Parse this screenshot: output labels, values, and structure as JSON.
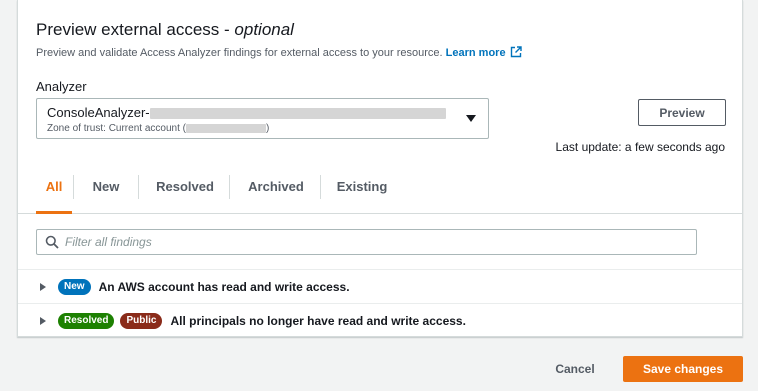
{
  "section": {
    "title_main": "Preview external access - ",
    "title_optional": "optional",
    "description": "Preview and validate Access Analyzer findings for external access to your resource.",
    "learn_more": "Learn more"
  },
  "analyzer": {
    "label": "Analyzer",
    "selected_name": "ConsoleAnalyzer-",
    "zone_prefix": "Zone of trust: Current account (",
    "zone_suffix": ")"
  },
  "preview_button": "Preview",
  "last_update": "Last update: a few seconds ago",
  "tabs": [
    {
      "label": "All"
    },
    {
      "label": "New"
    },
    {
      "label": "Resolved"
    },
    {
      "label": "Archived"
    },
    {
      "label": "Existing"
    }
  ],
  "filter": {
    "placeholder": "Filter all findings"
  },
  "findings": [
    {
      "badges": [
        {
          "label": "New",
          "color": "#0073bb"
        }
      ],
      "text": "An AWS account has read and write access."
    },
    {
      "badges": [
        {
          "label": "Resolved",
          "color": "#1d8102"
        },
        {
          "label": "Public",
          "color": "#8a2b1a"
        }
      ],
      "text": "All principals no longer have read and write access."
    }
  ],
  "footer": {
    "cancel": "Cancel",
    "save": "Save changes"
  },
  "colors": {
    "accent": "#ec7211",
    "link": "#0073bb",
    "badge_new": "#0073bb",
    "badge_resolved": "#1d8102",
    "badge_public": "#8a2b1a"
  },
  "icons": {
    "external_link": "external-link-icon",
    "search": "search-icon",
    "dropdown": "caret-down-icon",
    "expand": "caret-right-icon"
  }
}
